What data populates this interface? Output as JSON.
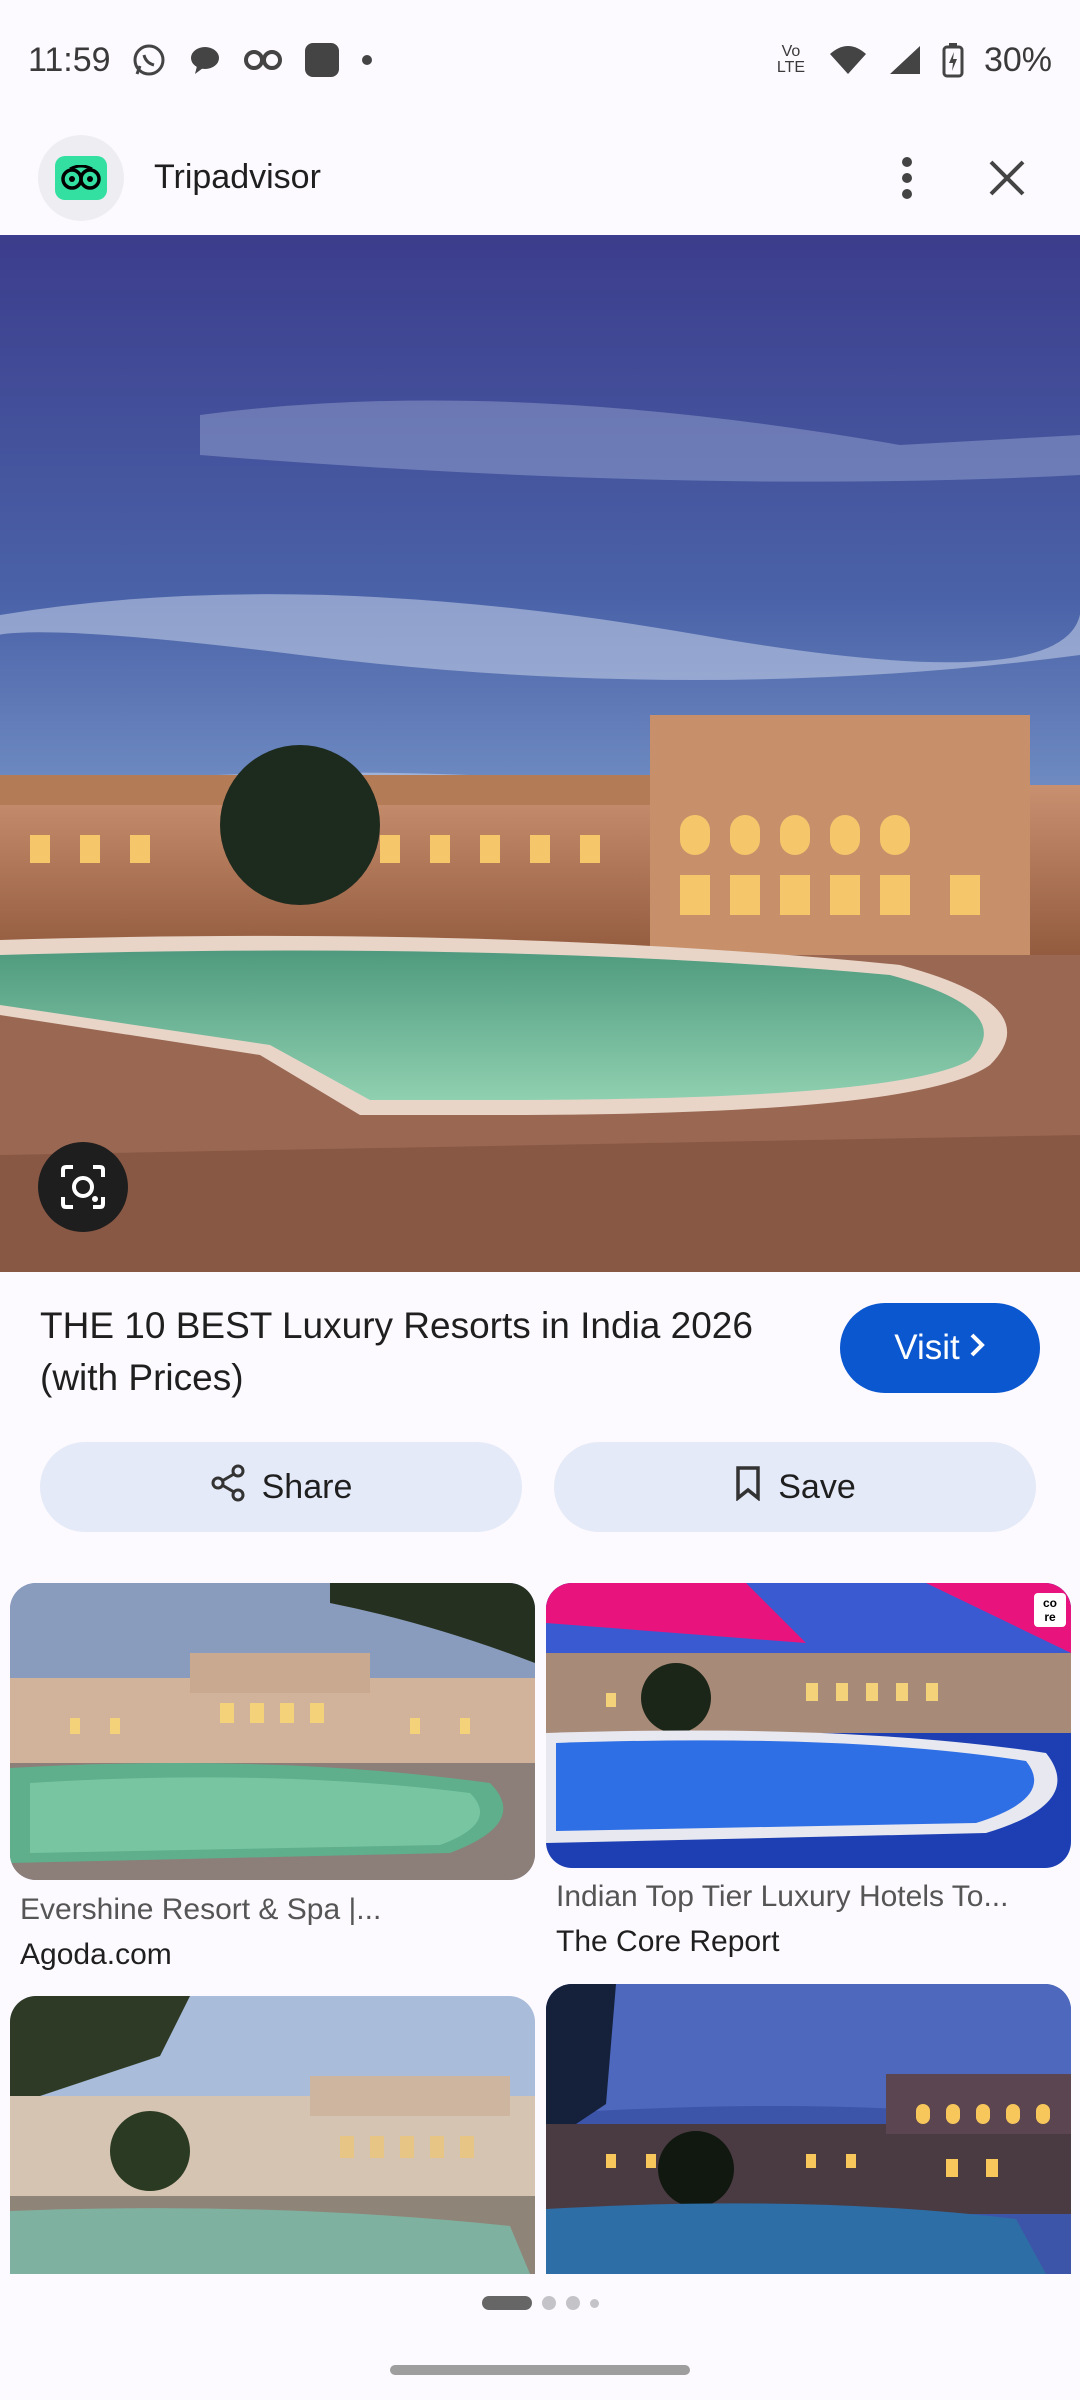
{
  "status": {
    "time": "11:59",
    "battery": "30%",
    "network": "Vo LTE",
    "left_icons": [
      "whatsapp-icon",
      "chat-bubble-icon",
      "glasses-icon",
      "app-square-icon",
      "dot-icon"
    ],
    "right_icons": [
      "wifi-icon",
      "signal-icon",
      "battery-icon"
    ]
  },
  "appbar": {
    "site_name": "Tripadvisor",
    "menu_icon": "more-vert-icon",
    "close_icon": "close-icon",
    "favicon_color": "#34e0a1"
  },
  "result": {
    "title": "THE 10 BEST Luxury Resorts in India 2026 (with Prices)",
    "visit_label": "Visit",
    "share_label": "Share",
    "save_label": "Save",
    "accent": "#0b57d0"
  },
  "related": [
    {
      "title": "Evershine Resort & Spa |...",
      "source": "Agoda.com"
    },
    {
      "title": "Indian Top Tier Luxury Hotels To...",
      "source": "The Core Report"
    },
    {
      "title": "",
      "source": ""
    },
    {
      "title": "",
      "source": ""
    }
  ],
  "thumb2_badge": "co re",
  "pager": {
    "count": 4,
    "active": 1
  }
}
